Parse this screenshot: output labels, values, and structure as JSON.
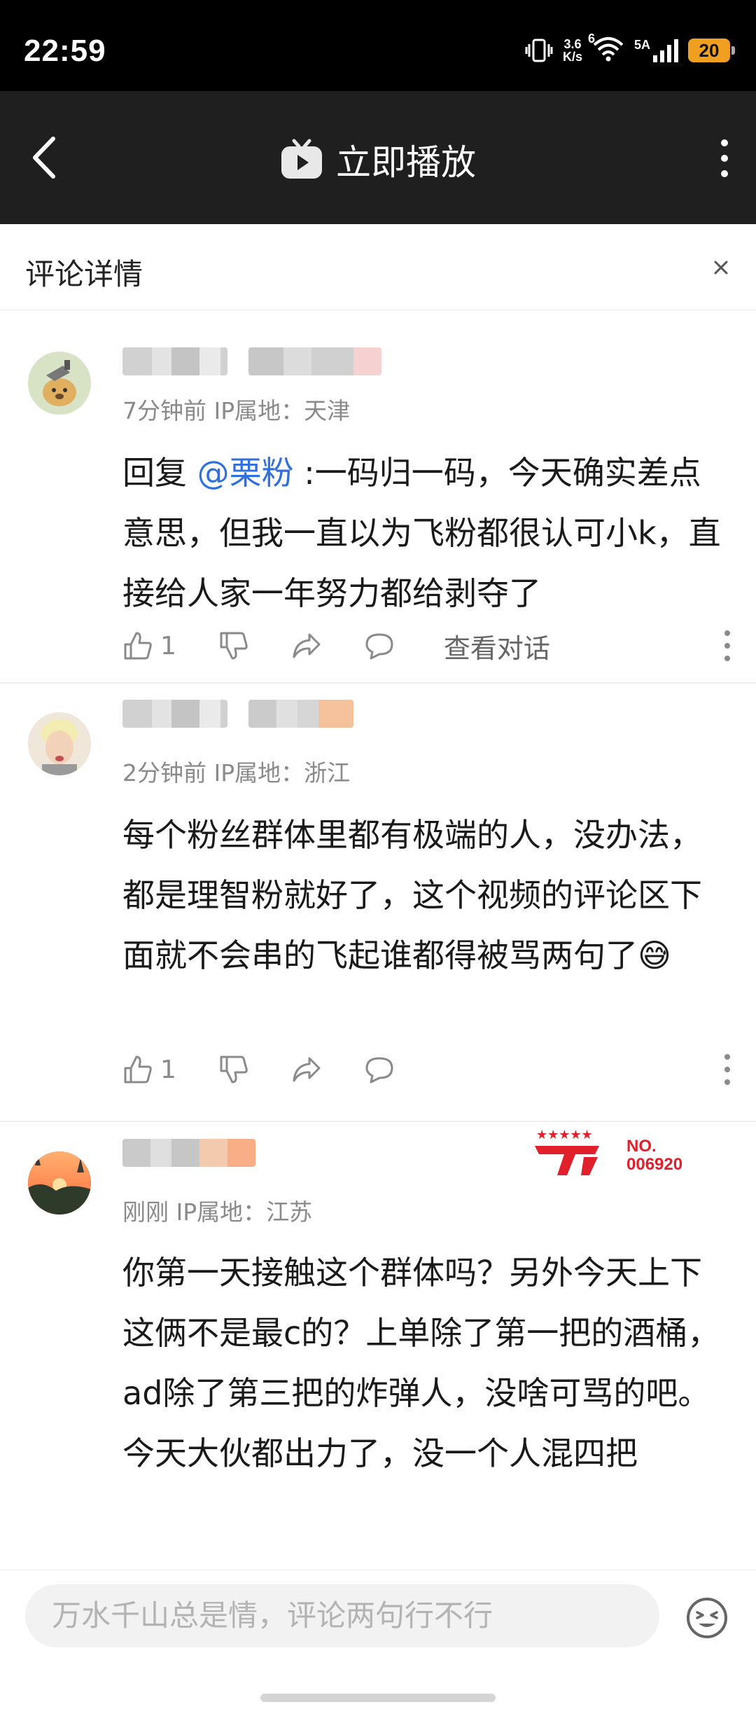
{
  "status_bar": {
    "time": "22:59",
    "net_speed_value": "3.6",
    "net_speed_unit": "K/s",
    "signal_label": "5A",
    "wifi_label": "6",
    "battery": "20",
    "battery_color": "#f0a020"
  },
  "top_bar": {
    "title": "立即播放",
    "icons": [
      "back-icon",
      "play-tv-icon",
      "more-vertical-icon"
    ]
  },
  "panel": {
    "title": "评论详情"
  },
  "comments": [
    {
      "meta": "7分钟前 IP属地：天津",
      "reply_prefix": "回复 ",
      "mention": "@栗粉",
      "text": " :一码归一码，今天确实差点意思，但我一直以为飞粉都很认可小k，直接给人家一年努力都给剥夺了",
      "likes": "1",
      "view_conversation": "查看对话"
    },
    {
      "meta": "2分钟前 IP属地：浙江",
      "text": "每个粉丝群体里都有极端的人，没办法，都是理智粉就好了，这个视频的评论区下面就不会串的飞起谁都得被骂两句了",
      "emoji": "😅",
      "likes": "1"
    },
    {
      "meta": "刚刚 IP属地：江苏",
      "text": "你第一天接触这个群体吗？另外今天上下这俩不是最c的？上单除了第一把的酒桶，ad除了第三把的炸弹人，没啥可骂的吧。今天大伙都出力了，没一个人混四把",
      "badge_stars": "★★★★★",
      "badge_text": "NO.",
      "badge_number": "006920",
      "badge_color": "#e0202a"
    }
  ],
  "bottom_bar": {
    "input_placeholder": "万水千山总是情，评论两句行不行"
  },
  "colors": {
    "accent_link": "#2f6fe0",
    "topbar_bg": "#1f1f1f",
    "meta_gray": "#8a8a8a"
  }
}
